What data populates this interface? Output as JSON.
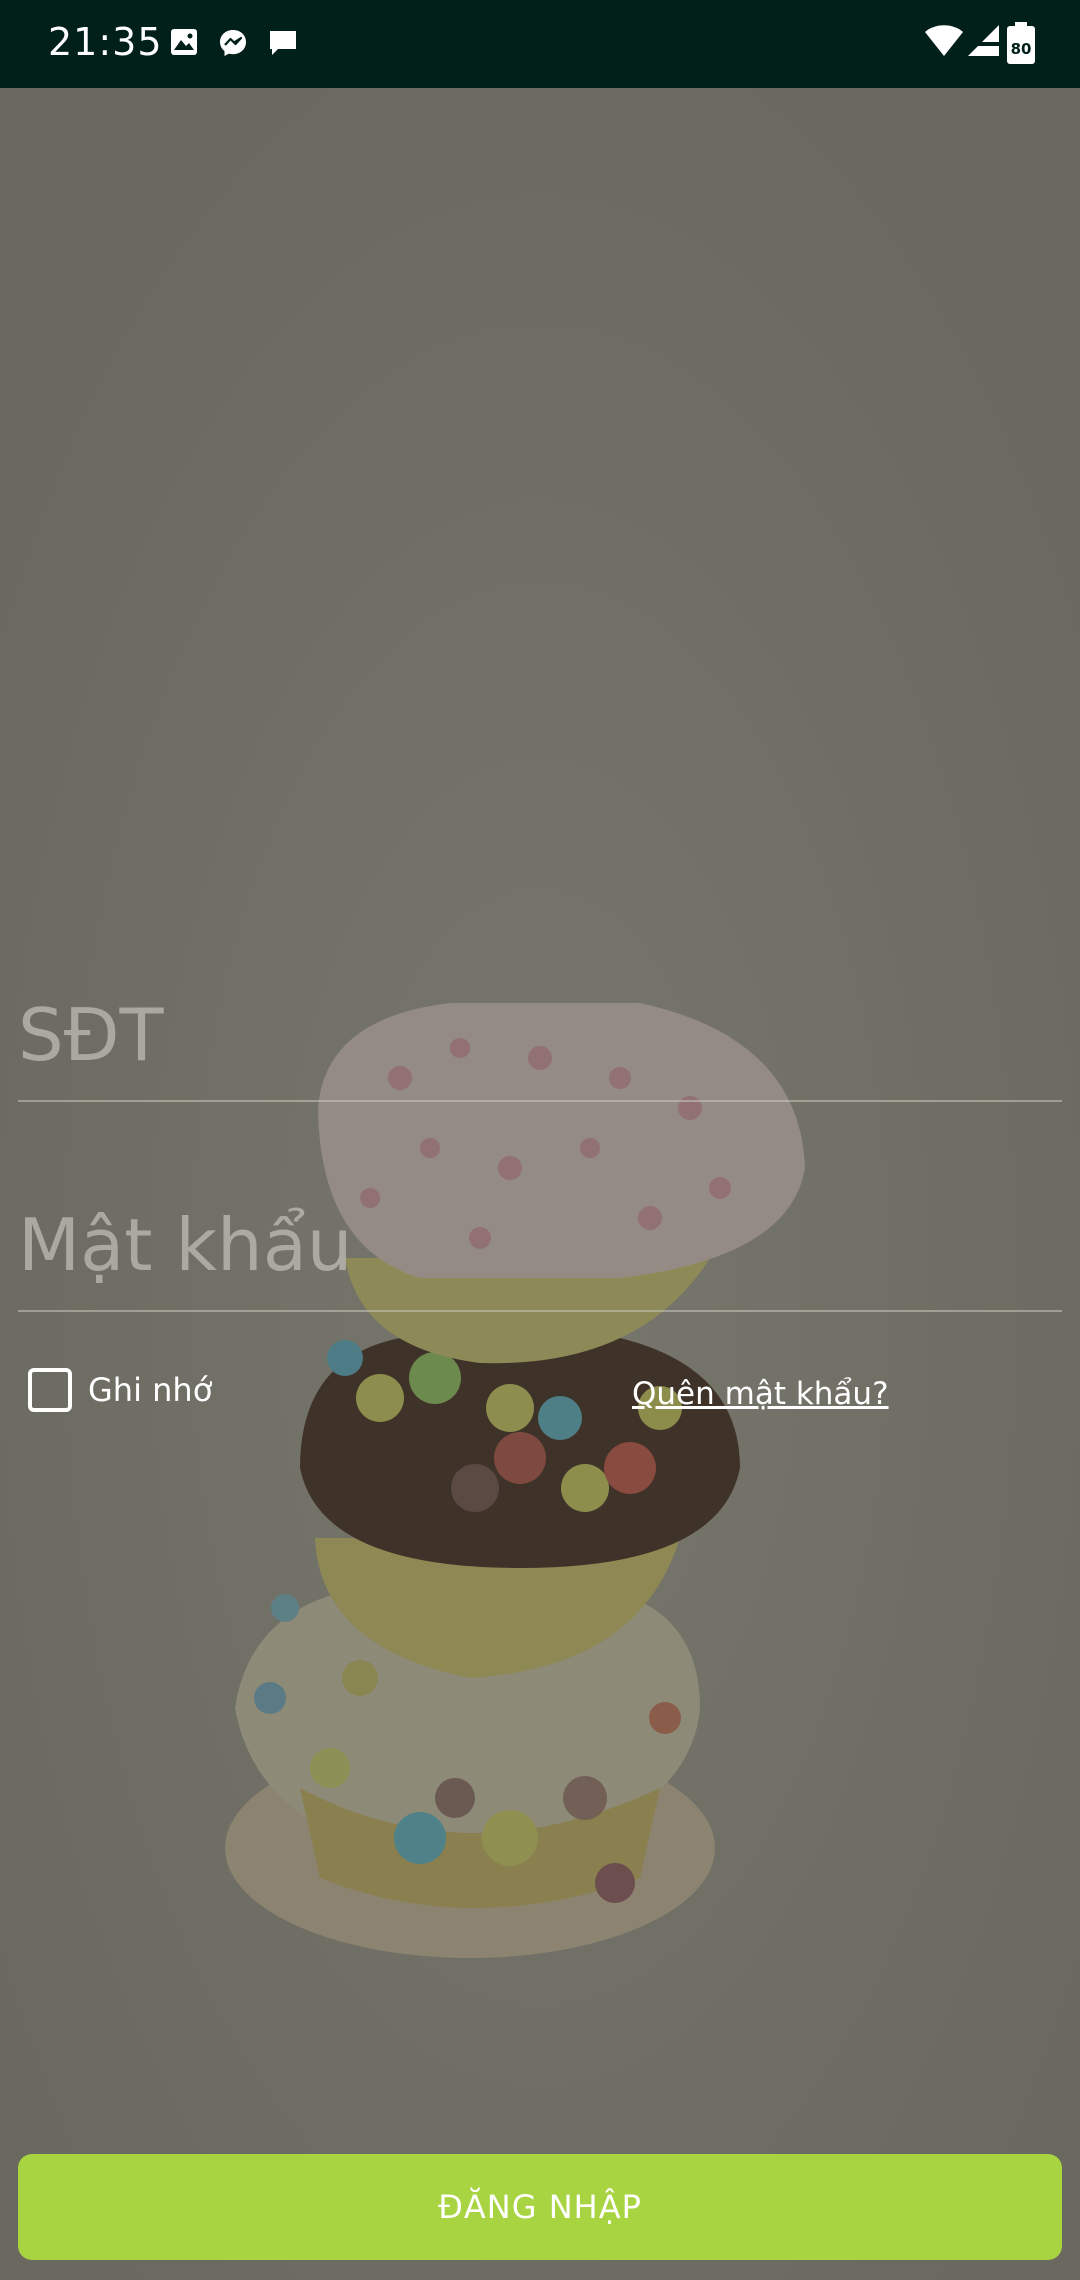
{
  "status_bar": {
    "time": "21:35",
    "battery": "80",
    "notification_icons": [
      "image-icon",
      "messenger-icon",
      "chat-icon"
    ],
    "system_icons": [
      "wifi-icon",
      "signal-icon",
      "battery-icon"
    ]
  },
  "form": {
    "phone_placeholder": "SĐT",
    "password_placeholder": "Mật khẩu",
    "remember_label": "Ghi nhớ",
    "remember_checked": false,
    "forgot_label": "Quên mật khẩu?",
    "login_label": "ĐĂNG NHẬP"
  },
  "colors": {
    "status_bar_bg": "#02201a",
    "overlay_bg": "#6e6d64",
    "login_button": "#a8d441",
    "text": "#ffffff"
  }
}
